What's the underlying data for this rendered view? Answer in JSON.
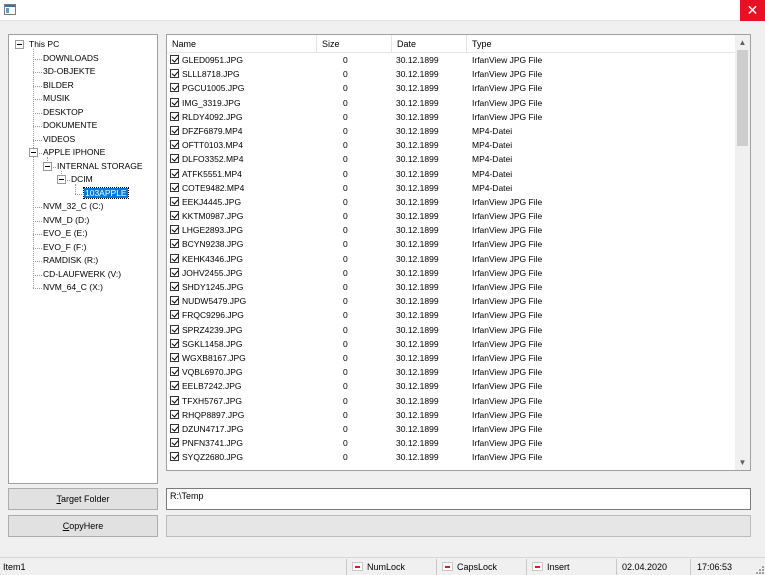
{
  "window": {
    "title": "",
    "close_icon": "close-icon",
    "accent": "#e81123"
  },
  "tree": {
    "selected_color": "#0078d7",
    "nodes": [
      {
        "label": "This PC",
        "level": 0,
        "expander": true
      },
      {
        "label": "DOWNLOADS",
        "level": 1
      },
      {
        "label": "3D-OBJEKTE",
        "level": 1
      },
      {
        "label": "BILDER",
        "level": 1
      },
      {
        "label": "MUSIK",
        "level": 1
      },
      {
        "label": "DESKTOP",
        "level": 1
      },
      {
        "label": "DOKUMENTE",
        "level": 1
      },
      {
        "label": "VIDEOS",
        "level": 1
      },
      {
        "label": "APPLE IPHONE",
        "level": 1,
        "expander": true
      },
      {
        "label": "INTERNAL STORAGE",
        "level": 2,
        "expander": true
      },
      {
        "label": "DCIM",
        "level": 3,
        "expander": true
      },
      {
        "label": "103APPLE",
        "level": 4,
        "selected": true
      },
      {
        "label": "NVM_32_C (C:)",
        "level": 1
      },
      {
        "label": "NVM_D (D:)",
        "level": 1
      },
      {
        "label": "EVO_E (E:)",
        "level": 1
      },
      {
        "label": "EVO_F (F:)",
        "level": 1
      },
      {
        "label": "RAMDISK (R:)",
        "level": 1
      },
      {
        "label": "CD-LAUFWERK (V:)",
        "level": 1
      },
      {
        "label": "NVM_64_C (X:)",
        "level": 1
      }
    ]
  },
  "list": {
    "columns": [
      "Name",
      "Size",
      "Date",
      "Type"
    ],
    "rows": [
      {
        "name": "GLED0951.JPG",
        "size": "0",
        "date": "30.12.1899",
        "type": "IrfanView JPG File"
      },
      {
        "name": "SLLL8718.JPG",
        "size": "0",
        "date": "30.12.1899",
        "type": "IrfanView JPG File"
      },
      {
        "name": "PGCU1005.JPG",
        "size": "0",
        "date": "30.12.1899",
        "type": "IrfanView JPG File"
      },
      {
        "name": "IMG_3319.JPG",
        "size": "0",
        "date": "30.12.1899",
        "type": "IrfanView JPG File"
      },
      {
        "name": "RLDY4092.JPG",
        "size": "0",
        "date": "30.12.1899",
        "type": "IrfanView JPG File"
      },
      {
        "name": "DFZF6879.MP4",
        "size": "0",
        "date": "30.12.1899",
        "type": "MP4-Datei"
      },
      {
        "name": "OFTT0103.MP4",
        "size": "0",
        "date": "30.12.1899",
        "type": "MP4-Datei"
      },
      {
        "name": "DLFO3352.MP4",
        "size": "0",
        "date": "30.12.1899",
        "type": "MP4-Datei"
      },
      {
        "name": "ATFK5551.MP4",
        "size": "0",
        "date": "30.12.1899",
        "type": "MP4-Datei"
      },
      {
        "name": "COTE9482.MP4",
        "size": "0",
        "date": "30.12.1899",
        "type": "MP4-Datei"
      },
      {
        "name": "EEKJ4445.JPG",
        "size": "0",
        "date": "30.12.1899",
        "type": "IrfanView JPG File"
      },
      {
        "name": "KKTM0987.JPG",
        "size": "0",
        "date": "30.12.1899",
        "type": "IrfanView JPG File"
      },
      {
        "name": "LHGE2893.JPG",
        "size": "0",
        "date": "30.12.1899",
        "type": "IrfanView JPG File"
      },
      {
        "name": "BCYN9238.JPG",
        "size": "0",
        "date": "30.12.1899",
        "type": "IrfanView JPG File"
      },
      {
        "name": "KEHK4346.JPG",
        "size": "0",
        "date": "30.12.1899",
        "type": "IrfanView JPG File"
      },
      {
        "name": "JOHV2455.JPG",
        "size": "0",
        "date": "30.12.1899",
        "type": "IrfanView JPG File"
      },
      {
        "name": "SHDY1245.JPG",
        "size": "0",
        "date": "30.12.1899",
        "type": "IrfanView JPG File"
      },
      {
        "name": "NUDW5479.JPG",
        "size": "0",
        "date": "30.12.1899",
        "type": "IrfanView JPG File"
      },
      {
        "name": "FRQC9296.JPG",
        "size": "0",
        "date": "30.12.1899",
        "type": "IrfanView JPG File"
      },
      {
        "name": "SPRZ4239.JPG",
        "size": "0",
        "date": "30.12.1899",
        "type": "IrfanView JPG File"
      },
      {
        "name": "SGKL1458.JPG",
        "size": "0",
        "date": "30.12.1899",
        "type": "IrfanView JPG File"
      },
      {
        "name": "WGXB8167.JPG",
        "size": "0",
        "date": "30.12.1899",
        "type": "IrfanView JPG File"
      },
      {
        "name": "VQBL6970.JPG",
        "size": "0",
        "date": "30.12.1899",
        "type": "IrfanView JPG File"
      },
      {
        "name": "EELB7242.JPG",
        "size": "0",
        "date": "30.12.1899",
        "type": "IrfanView JPG File"
      },
      {
        "name": "TFXH5767.JPG",
        "size": "0",
        "date": "30.12.1899",
        "type": "IrfanView JPG File"
      },
      {
        "name": "RHQP8897.JPG",
        "size": "0",
        "date": "30.12.1899",
        "type": "IrfanView JPG File"
      },
      {
        "name": "DZUN4717.JPG",
        "size": "0",
        "date": "30.12.1899",
        "type": "IrfanView JPG File"
      },
      {
        "name": "PNFN3741.JPG",
        "size": "0",
        "date": "30.12.1899",
        "type": "IrfanView JPG File"
      },
      {
        "name": "SYQZ2680.JPG",
        "size": "0",
        "date": "30.12.1899",
        "type": "IrfanView JPG File"
      }
    ]
  },
  "buttons": {
    "target_folder_accel": "T",
    "target_folder_rest": "arget Folder",
    "copy_here_accel": "C",
    "copy_here_rest": "opyHere"
  },
  "path": {
    "value": "R:\\Temp"
  },
  "progress": {
    "value": 0
  },
  "status": {
    "item": "Item1",
    "numlock": "NumLock",
    "capslock": "CapsLock",
    "insert": "Insert",
    "date": "02.04.2020",
    "time": "17:06:53",
    "indicator_color": "#d02020"
  }
}
